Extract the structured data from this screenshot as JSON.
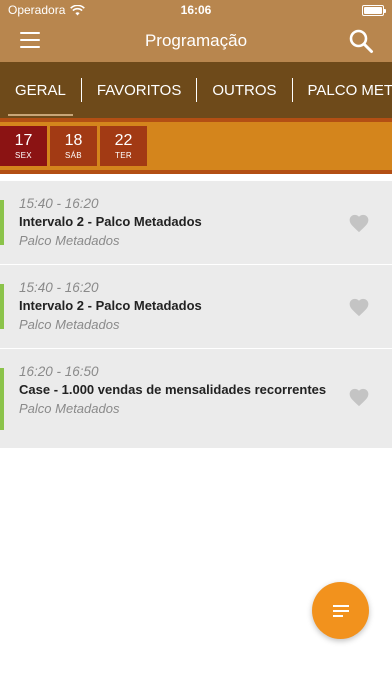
{
  "status_bar": {
    "carrier": "Operadora",
    "time": "16:06"
  },
  "app_bar": {
    "title": "Programação"
  },
  "tabs": [
    {
      "label": "GERAL",
      "active": true
    },
    {
      "label": "FAVORITOS",
      "active": false
    },
    {
      "label": "OUTROS",
      "active": false
    },
    {
      "label": "PALCO METADADOS",
      "active": false
    }
  ],
  "dates": [
    {
      "day": "17",
      "weekday": "SEX",
      "selected": true
    },
    {
      "day": "18",
      "weekday": "SÁB",
      "selected": false
    },
    {
      "day": "22",
      "weekday": "TER",
      "selected": false
    }
  ],
  "sessions": [
    {
      "time": "15:40 - 16:20",
      "title": "Intervalo 2 - Palco Metadados",
      "place": "Palco Metadados",
      "favorite": false
    },
    {
      "time": "15:40 - 16:20",
      "title": "Intervalo 2 - Palco Metadados",
      "place": "Palco Metadados",
      "favorite": false
    },
    {
      "time": "16:20 - 16:50",
      "title": "Case - 1.000 vendas de mensalidades recorrentes",
      "place": "Palco Metadados",
      "favorite": false
    }
  ],
  "colors": {
    "app_bar": "#b8864e",
    "tabs_bar": "#6e4a1a",
    "date_strip": "#d4851c",
    "date_selected": "#8b1313",
    "accent_green": "#8bc34a",
    "fab": "#f2921d"
  },
  "icons": {
    "menu": "hamburger-menu-icon",
    "search": "search-icon",
    "favorite": "heart-icon",
    "fab": "filter-list-icon",
    "wifi": "wifi-icon",
    "battery": "battery-icon"
  }
}
